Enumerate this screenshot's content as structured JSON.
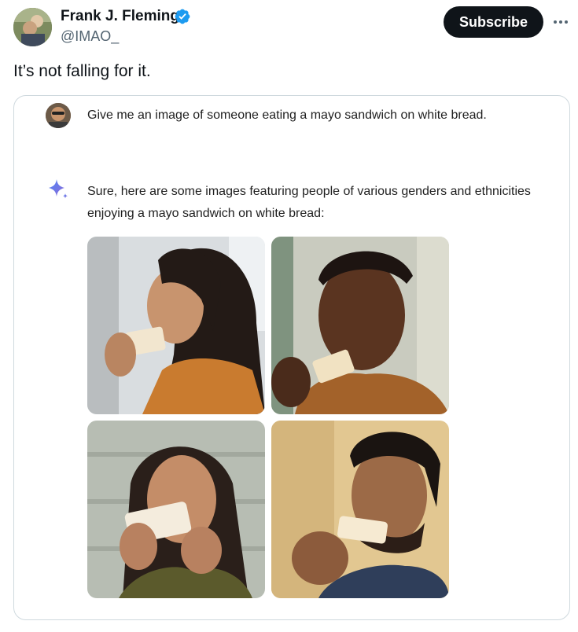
{
  "author": {
    "name": "Frank J. Fleming",
    "handle": "@IMAO_",
    "verified": true,
    "avatar_icon": "profile-photo"
  },
  "actions": {
    "subscribe_label": "Subscribe",
    "more_icon": "more-horizontal-icon"
  },
  "tweet": {
    "text": "It’s not falling for it."
  },
  "embedded_chat": {
    "user_prompt": "Give me an image of someone eating a mayo sandwich on white bread.",
    "assistant_icon": "gemini-sparkle-icon",
    "assistant_response": "Sure, here are some images featuring people of various genders and ethnicities enjoying a mayo sandwich on white bread:",
    "images": [
      {
        "subject": "woman-eating-sandwich-1"
      },
      {
        "subject": "man-eating-sandwich-1"
      },
      {
        "subject": "woman-eating-sandwich-2"
      },
      {
        "subject": "man-eating-sandwich-2"
      }
    ]
  },
  "colors": {
    "text": "#0f1419",
    "secondary": "#536471",
    "verified_blue": "#1d9bf0",
    "subscribe_bg": "#0f1419",
    "border": "#cfd9de"
  }
}
